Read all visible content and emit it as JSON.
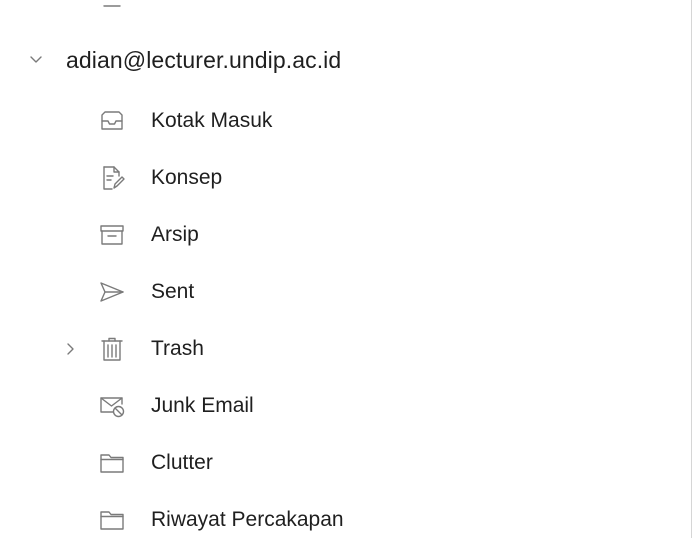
{
  "account": {
    "email": "adian@lecturer.undip.ac.id",
    "expanded": true
  },
  "folders": [
    {
      "label": "Kotak Masuk",
      "icon": "inbox-icon",
      "has_children": false
    },
    {
      "label": "Konsep",
      "icon": "drafts-icon",
      "has_children": false
    },
    {
      "label": "Arsip",
      "icon": "archive-icon",
      "has_children": false
    },
    {
      "label": "Sent",
      "icon": "sent-icon",
      "has_children": false
    },
    {
      "label": "Trash",
      "icon": "trash-icon",
      "has_children": true
    },
    {
      "label": "Junk Email",
      "icon": "junk-icon",
      "has_children": false
    },
    {
      "label": "Clutter",
      "icon": "folder-icon",
      "has_children": false
    },
    {
      "label": "Riwayat Percakapan",
      "icon": "folder-icon",
      "has_children": false
    }
  ],
  "colors": {
    "text": "#1f1f1f",
    "icon": "#7a7a7a",
    "divider": "#d6d6d6",
    "background": "#ffffff"
  }
}
